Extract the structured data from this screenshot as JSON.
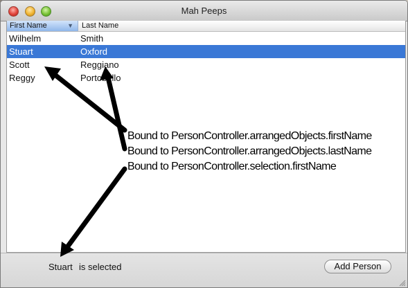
{
  "window": {
    "title": "Mah Peeps"
  },
  "table": {
    "columns": [
      {
        "label": "First Name",
        "sorted": true
      },
      {
        "label": "Last Name",
        "sorted": false
      }
    ],
    "rows": [
      {
        "first": "Wilhelm",
        "last": "Smith",
        "selected": false
      },
      {
        "first": "Stuart",
        "last": "Oxford",
        "selected": true
      },
      {
        "first": "Scott",
        "last": "Reggiano",
        "selected": false
      },
      {
        "first": "Reggy",
        "last": "Portobello",
        "selected": false
      }
    ]
  },
  "status": {
    "selected_name": "Stuart",
    "suffix": "is selected"
  },
  "add_button": {
    "label": "Add Person"
  },
  "annotations": [
    "Bound to PersonController.arrangedObjects.firstName",
    "Bound to PersonController.arrangedObjects.lastName",
    "Bound to PersonController.selection.firstName"
  ],
  "colors": {
    "selection": "#3a78d6",
    "arrow": "#000000"
  },
  "icons": {
    "sort": "triangle-down",
    "resize": "resize-grip"
  }
}
